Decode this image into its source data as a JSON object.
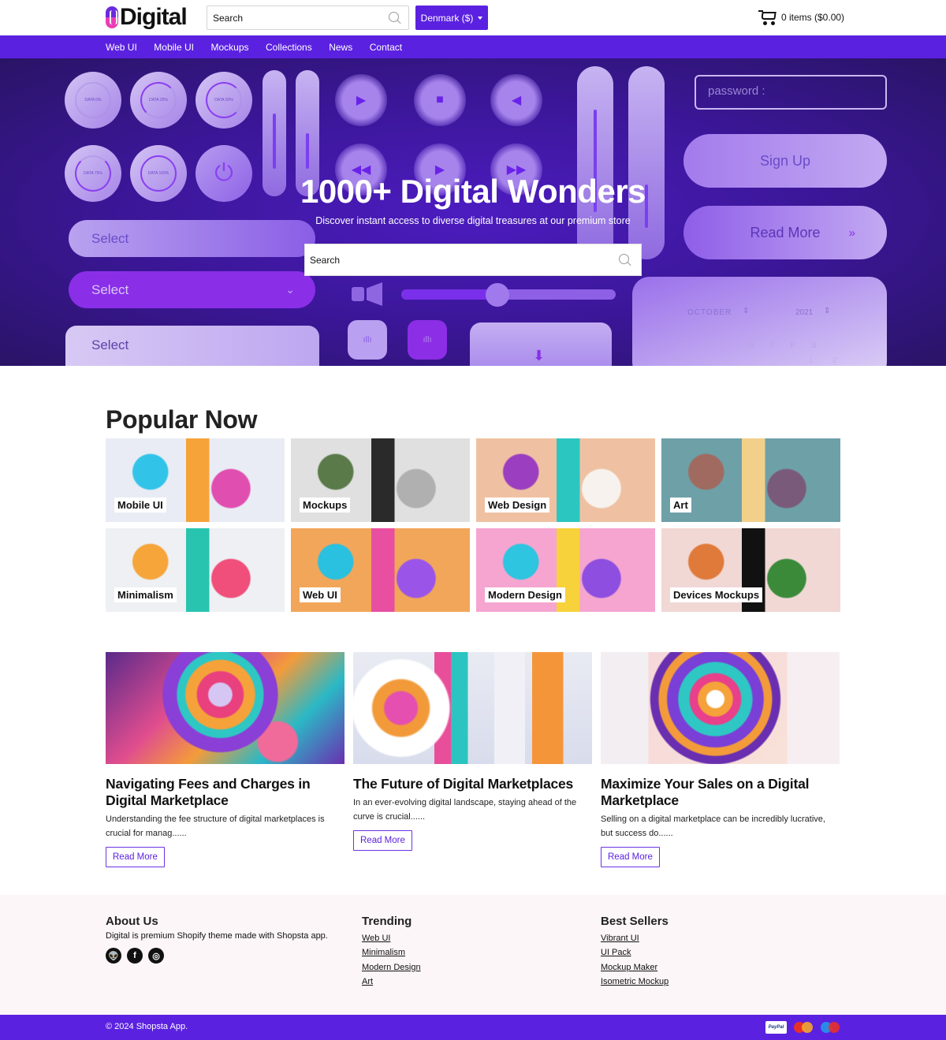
{
  "header": {
    "logo_text": "Digital",
    "search_placeholder": "Search",
    "country_label": "Denmark ($)",
    "cart_label": "0 items ($0.00)"
  },
  "nav": {
    "items": [
      "Web UI",
      "Mobile UI",
      "Mockups",
      "Collections",
      "News",
      "Contact"
    ]
  },
  "hero": {
    "title": "1000+ Digital Wonders",
    "subtitle": "Discover instant access to diverse digital treasures at our premium store",
    "search_placeholder": "Search",
    "background_art": {
      "dials": [
        "DATA 0%",
        "DATA 25%",
        "DATA 50%",
        "DATA 75%",
        "DATA 100%"
      ],
      "select_labels": [
        "Select",
        "Select",
        "Select"
      ],
      "password_placeholder": "password :",
      "signup_label": "Sign Up",
      "readmore_label": "Read More",
      "calendar_month": "OCTOBER",
      "calendar_year": "2021",
      "weekdays": [
        "S",
        "M",
        "T",
        "W",
        "T",
        "F",
        "S"
      ],
      "days": [
        "1",
        "2"
      ]
    }
  },
  "popular": {
    "title": "Popular Now",
    "tiles": [
      {
        "label": "Mobile UI",
        "colors": [
          "#e9ecf4",
          "#f6a33a",
          "#31c4e8",
          "#e04fb0"
        ]
      },
      {
        "label": "Mockups",
        "colors": [
          "#e0e0e0",
          "#2a2a2a",
          "#5a7a4a",
          "#b0b0b0"
        ]
      },
      {
        "label": "Web Design",
        "colors": [
          "#efc1a2",
          "#2cc6c1",
          "#9b3fc0",
          "#f7f2ee"
        ]
      },
      {
        "label": "Art",
        "colors": [
          "#6ea0a8",
          "#f2d08a",
          "#a06a60",
          "#7a5a7a"
        ]
      },
      {
        "label": "Minimalism",
        "colors": [
          "#eef0f4",
          "#28c4b0",
          "#f6a53a",
          "#ef4f7a"
        ]
      },
      {
        "label": "Web UI",
        "colors": [
          "#f2a65a",
          "#e84fa0",
          "#2ac0e0",
          "#9a55e8"
        ]
      },
      {
        "label": "Modern Design",
        "colors": [
          "#f5a5d0",
          "#f7d23a",
          "#2dc5e0",
          "#8e4fe0"
        ]
      },
      {
        "label": "Devices Mockups",
        "colors": [
          "#f1d8d5",
          "#111111",
          "#e07a3a",
          "#3a8a3a"
        ]
      }
    ]
  },
  "articles": [
    {
      "title": "Navigating Fees and Charges in Digital Marketplace",
      "excerpt": "Understanding the fee structure of digital marketplaces is crucial for manag......",
      "button": "Read More"
    },
    {
      "title": "The Future of Digital Marketplaces",
      "excerpt": "In an ever-evolving digital landscape, staying ahead of the curve is crucial......",
      "button": "Read More"
    },
    {
      "title": "Maximize Your Sales on a Digital Marketplace",
      "excerpt": "Selling on a digital marketplace can be incredibly lucrative, but success do......",
      "button": "Read More"
    }
  ],
  "footer": {
    "about": {
      "title": "About Us",
      "text": "Digital is premium Shopify theme made with Shopsta app.",
      "social": [
        "reddit-icon",
        "facebook-icon",
        "instagram-icon"
      ]
    },
    "trending": {
      "title": "Trending",
      "links": [
        "Web UI",
        "Minimalism",
        "Modern Design",
        "Art"
      ]
    },
    "best_sellers": {
      "title": "Best Sellers",
      "links": [
        "Vibrant UI",
        "UI Pack",
        "Mockup Maker",
        "Isometric Mockup"
      ]
    },
    "copyright": "© 2024 Shopsta App.",
    "payments": [
      "PayPal",
      "MasterCard",
      "Maestro"
    ]
  },
  "colors": {
    "brand": "#5b21e0",
    "footer_bg": "#fdf6f8",
    "hero_bg": "#3a1695"
  }
}
